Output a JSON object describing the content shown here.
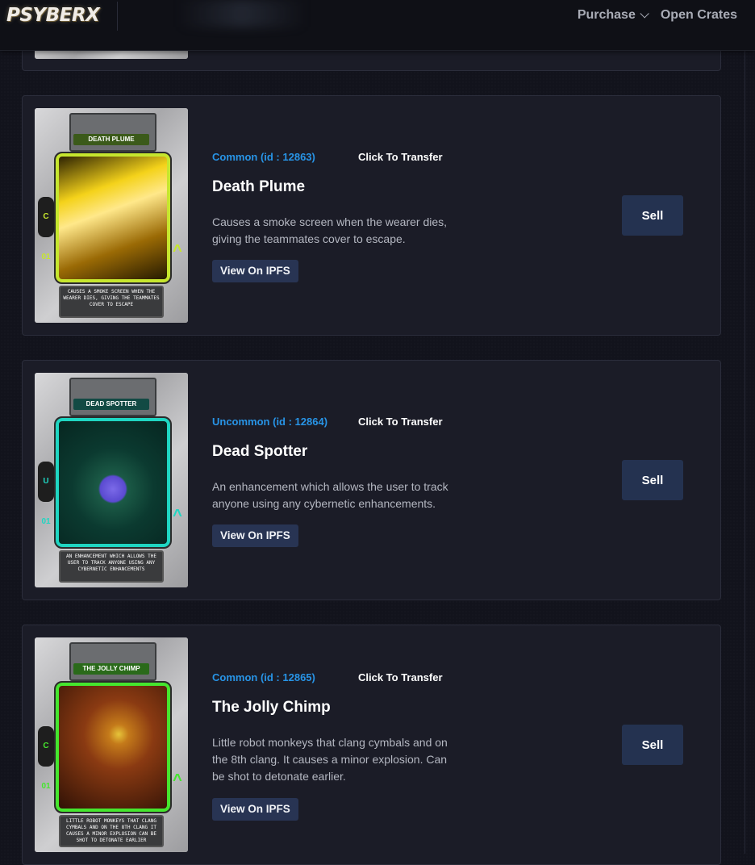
{
  "header": {
    "logo_text": "PSYBERX",
    "nav": [
      {
        "label": "Purchase",
        "has_dropdown": true
      },
      {
        "label": "Open Crates",
        "has_dropdown": false
      }
    ]
  },
  "items": [
    {
      "rarity": "Common (id : 12863)",
      "transfer_label": "Click To Transfer",
      "name": "Death Plume",
      "description": "Causes a smoke screen when the wearer dies, giving the teammates cover to escape.",
      "ipfs_label": "View On IPFS",
      "sell_label": "Sell",
      "card_image": {
        "title": "DEATH PLUME",
        "side_code": "C 01",
        "caption": "CAUSES A SMOKE SCREEN WHEN THE WEARER DIES, GIVING THE TEAMMATES COVER TO ESCAPE",
        "accent": "#c6e62e",
        "art_colors": [
          "#1a1200",
          "#f4d21a",
          "#9a6a05"
        ]
      }
    },
    {
      "rarity": "Uncommon (id : 12864)",
      "transfer_label": "Click To Transfer",
      "name": "Dead Spotter",
      "description": "An enhancement which allows the user to track anyone using any cybernetic enhancements.",
      "ipfs_label": "View On IPFS",
      "sell_label": "Sell",
      "card_image": {
        "title": "DEAD SPOTTER",
        "side_code": "U 01",
        "caption": "AN ENHANCEMENT WHICH ALLOWS THE USER TO TRACK ANYONE USING ANY CYBERNETIC ENHANCEMENTS",
        "accent": "#1fd6c2",
        "art_colors": [
          "#06241f",
          "#1b5a46",
          "#7b6ae8"
        ]
      }
    },
    {
      "rarity": "Common (id : 12865)",
      "transfer_label": "Click To Transfer",
      "name": "The Jolly Chimp",
      "description": "Little robot monkeys that clang cymbals and on the 8th clang. It causes a minor explosion. Can be shot to detonate earlier.",
      "ipfs_label": "View On IPFS",
      "sell_label": "Sell",
      "card_image": {
        "title": "THE JOLLY CHIMP",
        "side_code": "C 01",
        "caption": "LITTLE ROBOT MONKEYS THAT CLANG CYMBALS AND ON THE 8TH CLANG IT CAUSES A MINOR EXPLOSION CAN BE SHOT TO DETONATE EARLIER",
        "accent": "#45e62e",
        "art_colors": [
          "#2a0f05",
          "#8a3a12",
          "#e6c43a"
        ]
      }
    }
  ],
  "colors": {
    "page_bg": "#12131c",
    "card_bg": "#1b1c27",
    "rarity_text": "#2894e6",
    "button_bg": "#283453"
  }
}
